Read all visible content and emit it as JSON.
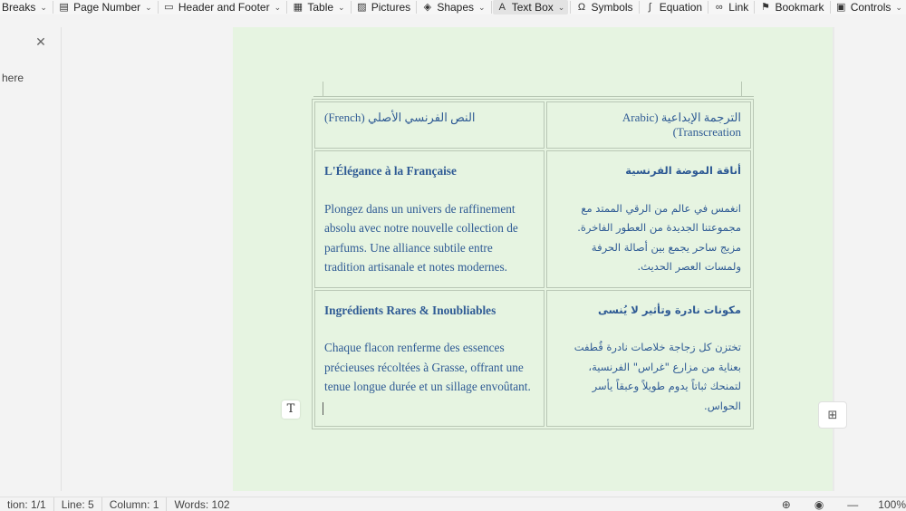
{
  "ribbon": {
    "items": [
      {
        "label": "Breaks",
        "icon": "breaks-icon",
        "glyph": "",
        "dropdown": true
      },
      {
        "label": "Page Number",
        "icon": "page-number-icon",
        "glyph": "▤",
        "dropdown": true
      },
      {
        "label": "Header and Footer",
        "icon": "header-footer-icon",
        "glyph": "▭",
        "dropdown": true
      },
      {
        "label": "Table",
        "icon": "table-icon",
        "glyph": "▦",
        "dropdown": true
      },
      {
        "label": "Pictures",
        "icon": "pictures-icon",
        "glyph": "▨",
        "dropdown": false
      },
      {
        "label": "Shapes",
        "icon": "shapes-icon",
        "glyph": "◈",
        "dropdown": true
      },
      {
        "label": "Text Box",
        "icon": "text-box-icon",
        "glyph": "A",
        "dropdown": true
      },
      {
        "label": "Symbols",
        "icon": "symbols-icon",
        "glyph": "Ω",
        "dropdown": false
      },
      {
        "label": "Equation",
        "icon": "equation-icon",
        "glyph": "∫",
        "dropdown": false
      },
      {
        "label": "Link",
        "icon": "link-icon",
        "glyph": "∞",
        "dropdown": false
      },
      {
        "label": "Bookmark",
        "icon": "bookmark-icon",
        "glyph": "⚑",
        "dropdown": false
      },
      {
        "label": "Controls",
        "icon": "controls-icon",
        "glyph": "▣",
        "dropdown": true
      }
    ]
  },
  "leftpane": {
    "hint": "here",
    "close_glyph": "✕"
  },
  "table": {
    "headers": {
      "french": "(French) النص الفرنسي الأصلي",
      "arabic": "الترجمة الإبداعية (Arabic Transcreation)"
    },
    "rows": [
      {
        "fr_title": "L'Élégance à la Française",
        "fr_body": "Plongez dans un univers de raffinement absolu avec notre nouvelle collection de parfums. Une alliance subtile entre tradition artisanale et notes modernes.",
        "ar_title": "أناقة الموضة الفرنسية",
        "ar_body": "انغمس في عالم من الرقي الممتد مع مجموعتنا الجديدة من العطور الفاخرة. مزيج ساحر يجمع بين أصالة الحرفة ولمسات العصر الحديث."
      },
      {
        "fr_title": "Ingrédients Rares & Inoubliables",
        "fr_body": "Chaque flacon renferme des essences précieuses récoltées à Grasse, offrant une tenue longue durée  et un sillage envoûtant.",
        "ar_title": "مكونات نادرة وتأثير  لا يُنسى",
        "ar_body": "تختزن كل زجاجة خلاصات نادرة قُطفت بعناية من مزارع \"غراس\" الفرنسية، لتمنحك ثباتاً يدوم طويلاً وعبقاً يأسر الحواس."
      }
    ]
  },
  "textbox_glyph": "T",
  "comment_glyph": "⊞",
  "status": {
    "section": "tion: 1/1",
    "line": "Line: 5",
    "column": "Column: 1",
    "words": "Words: 102",
    "zoom": "100%",
    "globe_glyph": "⊕",
    "view_glyph": "◉",
    "minus_glyph": "—"
  },
  "colors": {
    "page": "#e6f4e1",
    "text": "#2e5a94",
    "border": "#b9c7b5"
  }
}
